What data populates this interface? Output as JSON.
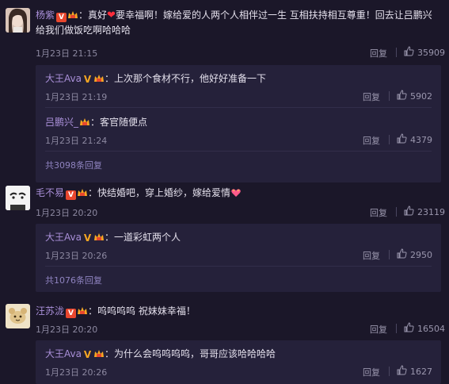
{
  "comments": [
    {
      "user": "杨紫",
      "text_a": "：真好",
      "text_b": "要幸福啊！嫁给爱的人两个人相伴过一生 互相扶持相互尊重！回去让吕鹏兴",
      "text_line2": "给我们做饭吃啊哈哈哈",
      "time": "1月23日 21:15",
      "reply_label": "回复",
      "likes": "35909",
      "replies": [
        {
          "user": "大王Ava",
          "text": "：上次那个食材不行，他好好准备一下",
          "time": "1月23日 21:19",
          "reply_label": "回复",
          "likes": "5902"
        },
        {
          "user": "吕鹏兴_",
          "text": "：客官随便点",
          "time": "1月23日 21:24",
          "reply_label": "回复",
          "likes": "4379"
        }
      ],
      "more": "共3098条回复"
    },
    {
      "user": "毛不易",
      "text": "：快结婚吧，穿上婚纱，嫁给爱情",
      "time": "1月23日 20:20",
      "reply_label": "回复",
      "likes": "23119",
      "replies": [
        {
          "user": "大王Ava",
          "text": "：一道彩虹两个人",
          "time": "1月23日 20:26",
          "reply_label": "回复",
          "likes": "2950"
        }
      ],
      "more": "共1076条回复"
    },
    {
      "user": "汪苏泷",
      "text": "：呜呜呜呜 祝妹妹幸福！",
      "time": "1月23日 20:20",
      "reply_label": "回复",
      "likes": "16504",
      "replies": [
        {
          "user": "大王Ava",
          "text": "：为什么会呜呜呜呜，哥哥应该哈哈哈哈",
          "time": "1月23日 20:26",
          "reply_label": "回复",
          "likes": "1627"
        }
      ]
    }
  ],
  "badges": {
    "v": "V"
  },
  "icons": {
    "like": "thumbs-up-icon",
    "verified": "verified-v-icon",
    "crown": "crown-badge-icon"
  },
  "colors": {
    "background": "#1b1729",
    "panel": "#25213a",
    "username": "#a98fd8",
    "heart": "#ff2d3b",
    "badge_red": "#e8472e",
    "badge_gold": "#f5a623"
  }
}
